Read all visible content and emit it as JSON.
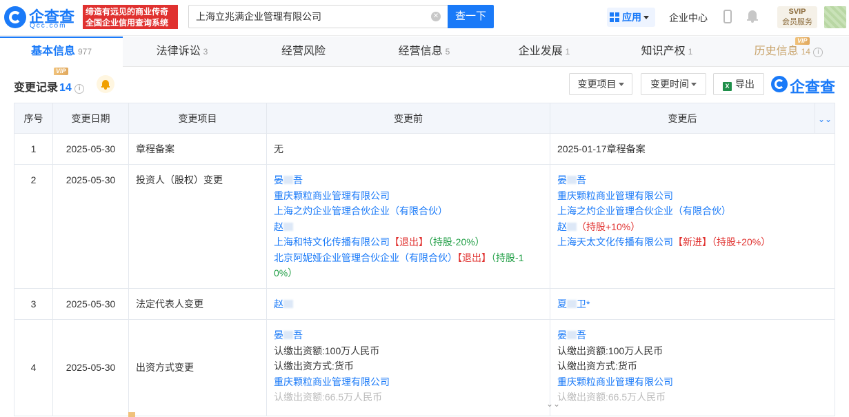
{
  "brand": {
    "name": "企查查",
    "domain": "Qcc.com",
    "slogan_line1": "缔造有远见的商业传奇",
    "slogan_line2": "全国企业信用查询系统"
  },
  "search": {
    "value": "上海立兆满企业管理有限公司",
    "button_label": "查一下"
  },
  "header": {
    "app_label": "应用",
    "enterprise_center": "企业中心",
    "svip_label": "SVIP",
    "member_service": "会员服务"
  },
  "tabs": [
    {
      "label": "基本信息",
      "count": "977"
    },
    {
      "label": "法律诉讼",
      "count": "3"
    },
    {
      "label": "经营风险",
      "count": ""
    },
    {
      "label": "经营信息",
      "count": "5"
    },
    {
      "label": "企业发展",
      "count": "1"
    },
    {
      "label": "知识产权",
      "count": "1"
    },
    {
      "label": "历史信息",
      "count": "14",
      "badge": "VIP"
    }
  ],
  "section": {
    "title": "变更记录",
    "count": "14",
    "badge": "VIP",
    "filter_item": "变更项目",
    "filter_time": "变更时间",
    "export": "导出",
    "watermark_logo": "企查查"
  },
  "table": {
    "headers": [
      "序号",
      "变更日期",
      "变更项目",
      "变更前",
      "变更后"
    ],
    "rows": [
      {
        "index": "1",
        "date": "2025-05-30",
        "item": "章程备案",
        "before_text": "无",
        "after_text": "2025-01-17章程备案"
      },
      {
        "index": "2",
        "date": "2025-05-30",
        "item": "投资人（股权）变更",
        "before": [
          {
            "name": "晏",
            "blur": true,
            "tail": "吾"
          },
          {
            "name": "重庆颗粒商业管理有限公司"
          },
          {
            "name": "上海之灼企业管理合伙企业（有限合伙）"
          },
          {
            "name": "赵",
            "blur": true
          },
          {
            "name": "上海和特文化传播有限公司",
            "tag": "【退出】",
            "share": "（持股-20%）"
          },
          {
            "name": "北京阿妮娅企业管理合伙企业（有限合伙）",
            "tag": "【退出】",
            "share": "（持股-1",
            "share2": "0%）"
          }
        ],
        "after": [
          {
            "name": "晏",
            "blur": true,
            "tail": "吾"
          },
          {
            "name": "重庆颗粒商业管理有限公司"
          },
          {
            "name": "上海之灼企业管理合伙企业（有限合伙）"
          },
          {
            "name": "赵",
            "blur": true,
            "share": "（持股+10%）"
          },
          {
            "name": "上海天太文化传播有限公司",
            "tag": "【新进】",
            "share": "（持股+20%）"
          }
        ]
      },
      {
        "index": "3",
        "date": "2025-05-30",
        "item": "法定代表人变更",
        "before_name": "赵",
        "after_name": "夏",
        "after_tail": "卫*"
      },
      {
        "index": "4",
        "date": "2025-05-30",
        "item": "出资方式变更",
        "before": {
          "holder1": "晏",
          "holder1_tail": "吾",
          "line1": "认缴出资额:100万人民币",
          "line2": "认缴出资方式:货币",
          "holder2": "重庆颗粒商业管理有限公司",
          "line3": "认缴出资额:66.5万人民币"
        },
        "after": {
          "holder1": "晏",
          "holder1_tail": "吾",
          "line1": "认缴出资额:100万人民币",
          "line2": "认缴出资方式:货币",
          "holder2": "重庆颗粒商业管理有限公司",
          "line3": "认缴出资额:66.5万人民币"
        }
      }
    ]
  },
  "colors": {
    "accent": "#1a7af8",
    "exit_tag": "#e0312f",
    "share_down": "#1f9e44",
    "share_up": "#e0312f",
    "vip": "#e1a95f"
  }
}
